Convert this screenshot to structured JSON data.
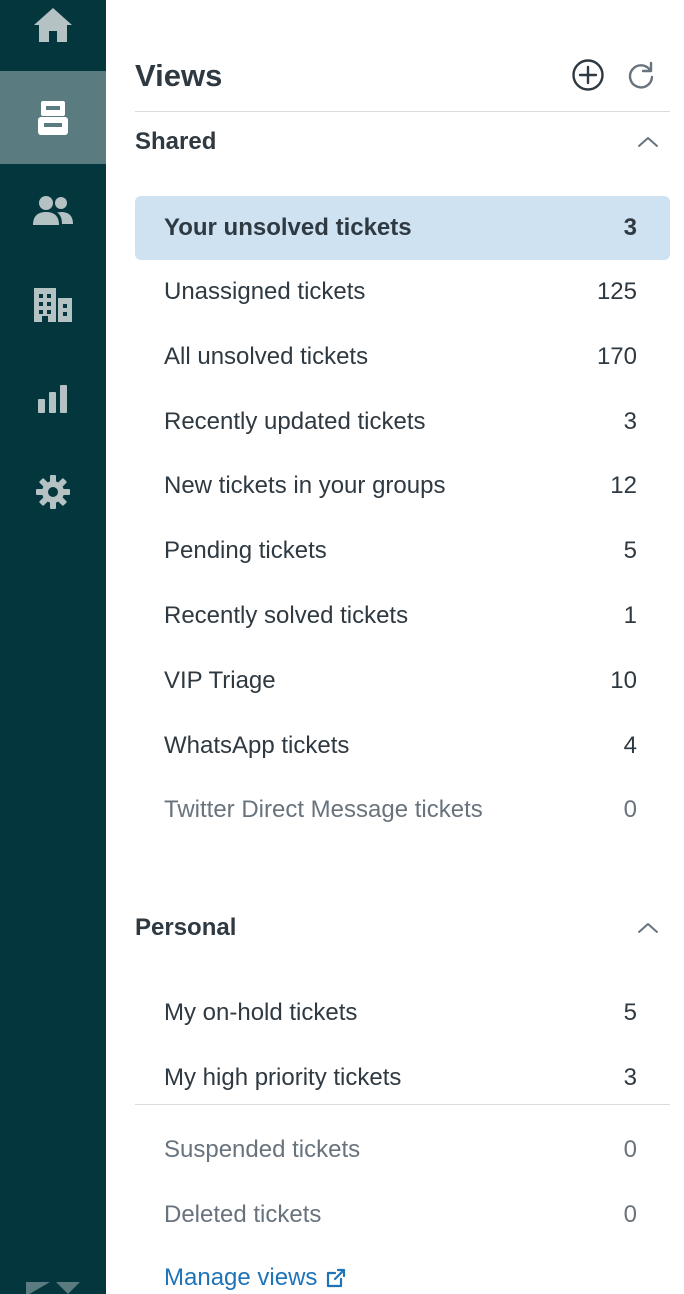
{
  "nav": {
    "items": [
      {
        "name": "home-icon",
        "active": false
      },
      {
        "name": "views-icon",
        "active": true
      },
      {
        "name": "customers-icon",
        "active": false
      },
      {
        "name": "organizations-icon",
        "active": false
      },
      {
        "name": "reporting-icon",
        "active": false
      },
      {
        "name": "admin-gear-icon",
        "active": false
      }
    ]
  },
  "header": {
    "title": "Views",
    "add_icon": "plus-circle-icon",
    "refresh_icon": "refresh-icon"
  },
  "shared": {
    "title": "Shared",
    "views": [
      {
        "label": "Your unsolved tickets",
        "count": "3",
        "selected": true
      },
      {
        "label": "Unassigned tickets",
        "count": "125"
      },
      {
        "label": "All unsolved tickets",
        "count": "170"
      },
      {
        "label": "Recently updated tickets",
        "count": "3"
      },
      {
        "label": "New tickets in your groups",
        "count": "12"
      },
      {
        "label": "Pending tickets",
        "count": "5"
      },
      {
        "label": "Recently solved tickets",
        "count": "1"
      },
      {
        "label": "VIP Triage",
        "count": "10"
      },
      {
        "label": "WhatsApp tickets",
        "count": "4"
      },
      {
        "label": "Twitter Direct Message tickets",
        "count": "0",
        "muted": true
      }
    ]
  },
  "personal": {
    "title": "Personal",
    "views": [
      {
        "label": "My on-hold tickets",
        "count": "5"
      },
      {
        "label": "My high priority tickets",
        "count": "3"
      }
    ]
  },
  "system": {
    "views": [
      {
        "label": "Suspended tickets",
        "count": "0",
        "muted": true
      },
      {
        "label": "Deleted tickets",
        "count": "0",
        "muted": true
      }
    ]
  },
  "footer": {
    "manage_label": "Manage views",
    "manage_icon": "external-link-icon"
  },
  "colors": {
    "rail_bg": "#03363d",
    "rail_active": "#5a7c80",
    "selected_bg": "#cee2f2",
    "link": "#1f73b7",
    "muted_text": "#68737d"
  }
}
